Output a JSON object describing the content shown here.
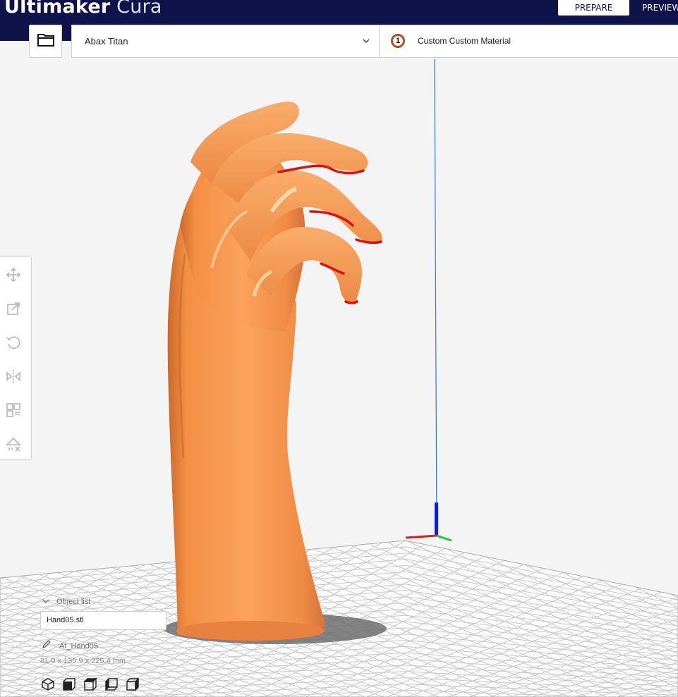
{
  "app": {
    "brand_bold": "Ultimaker",
    "brand_light": "Cura"
  },
  "stages": {
    "prepare": "PREPARE",
    "preview": "PREVIEW"
  },
  "toolbar": {
    "open_icon": "folder-icon",
    "printer": "Abax Titan",
    "printer_icon": "chevron-down-icon",
    "extruder_number": "1",
    "material": "Custom Custom Material"
  },
  "tools": [
    "move-icon",
    "scale-icon",
    "rotate-icon",
    "mirror-icon",
    "per-model-settings-icon",
    "support-blocker-icon"
  ],
  "object_list": {
    "header": "Object list",
    "item": "Hand05.stl",
    "name": "At_Hand05",
    "dimensions": "81.0 x 135.9 x 225.4 mm"
  },
  "view_buttons": [
    "3d-view-icon",
    "front-view-icon",
    "top-view-icon",
    "left-view-icon",
    "right-view-icon"
  ],
  "colors": {
    "header": "#10124a",
    "model": "#f4954a",
    "overhang": "#e01010",
    "grid": "#cfcfcf"
  }
}
